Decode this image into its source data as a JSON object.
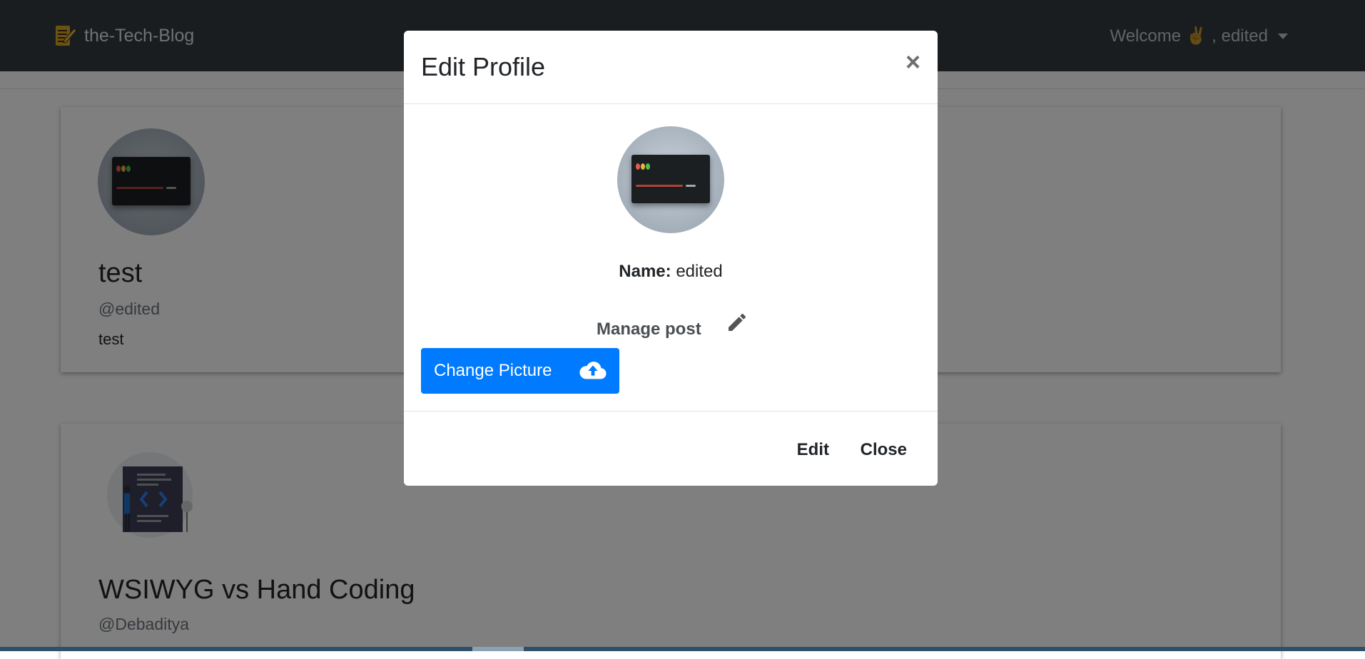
{
  "navbar": {
    "brand": "the-Tech-Blog",
    "welcome": "Welcome ✌️ , edited"
  },
  "profile_card": {
    "name": "test",
    "handle": "@edited",
    "bio": "test"
  },
  "post_card": {
    "title": "WSIWYG vs Hand Coding",
    "author": "@Debaditya"
  },
  "modal": {
    "title": "Edit Profile",
    "close_symbol": "×",
    "name_label": "Name:",
    "name_value": "edited",
    "manage_post": "Manage post",
    "change_picture": "Change Picture",
    "edit_button": "Edit",
    "close_button": "Close"
  },
  "icons": {
    "close": "close-icon",
    "pencil": "pencil-icon",
    "upload": "cloud-upload-icon",
    "dropdown": "caret-down-icon",
    "logo": "notepad-pen-icon"
  },
  "colors": {
    "navbar": "#343a40",
    "primary": "#007bff",
    "backdrop": "rgba(0,0,0,0.5)"
  }
}
